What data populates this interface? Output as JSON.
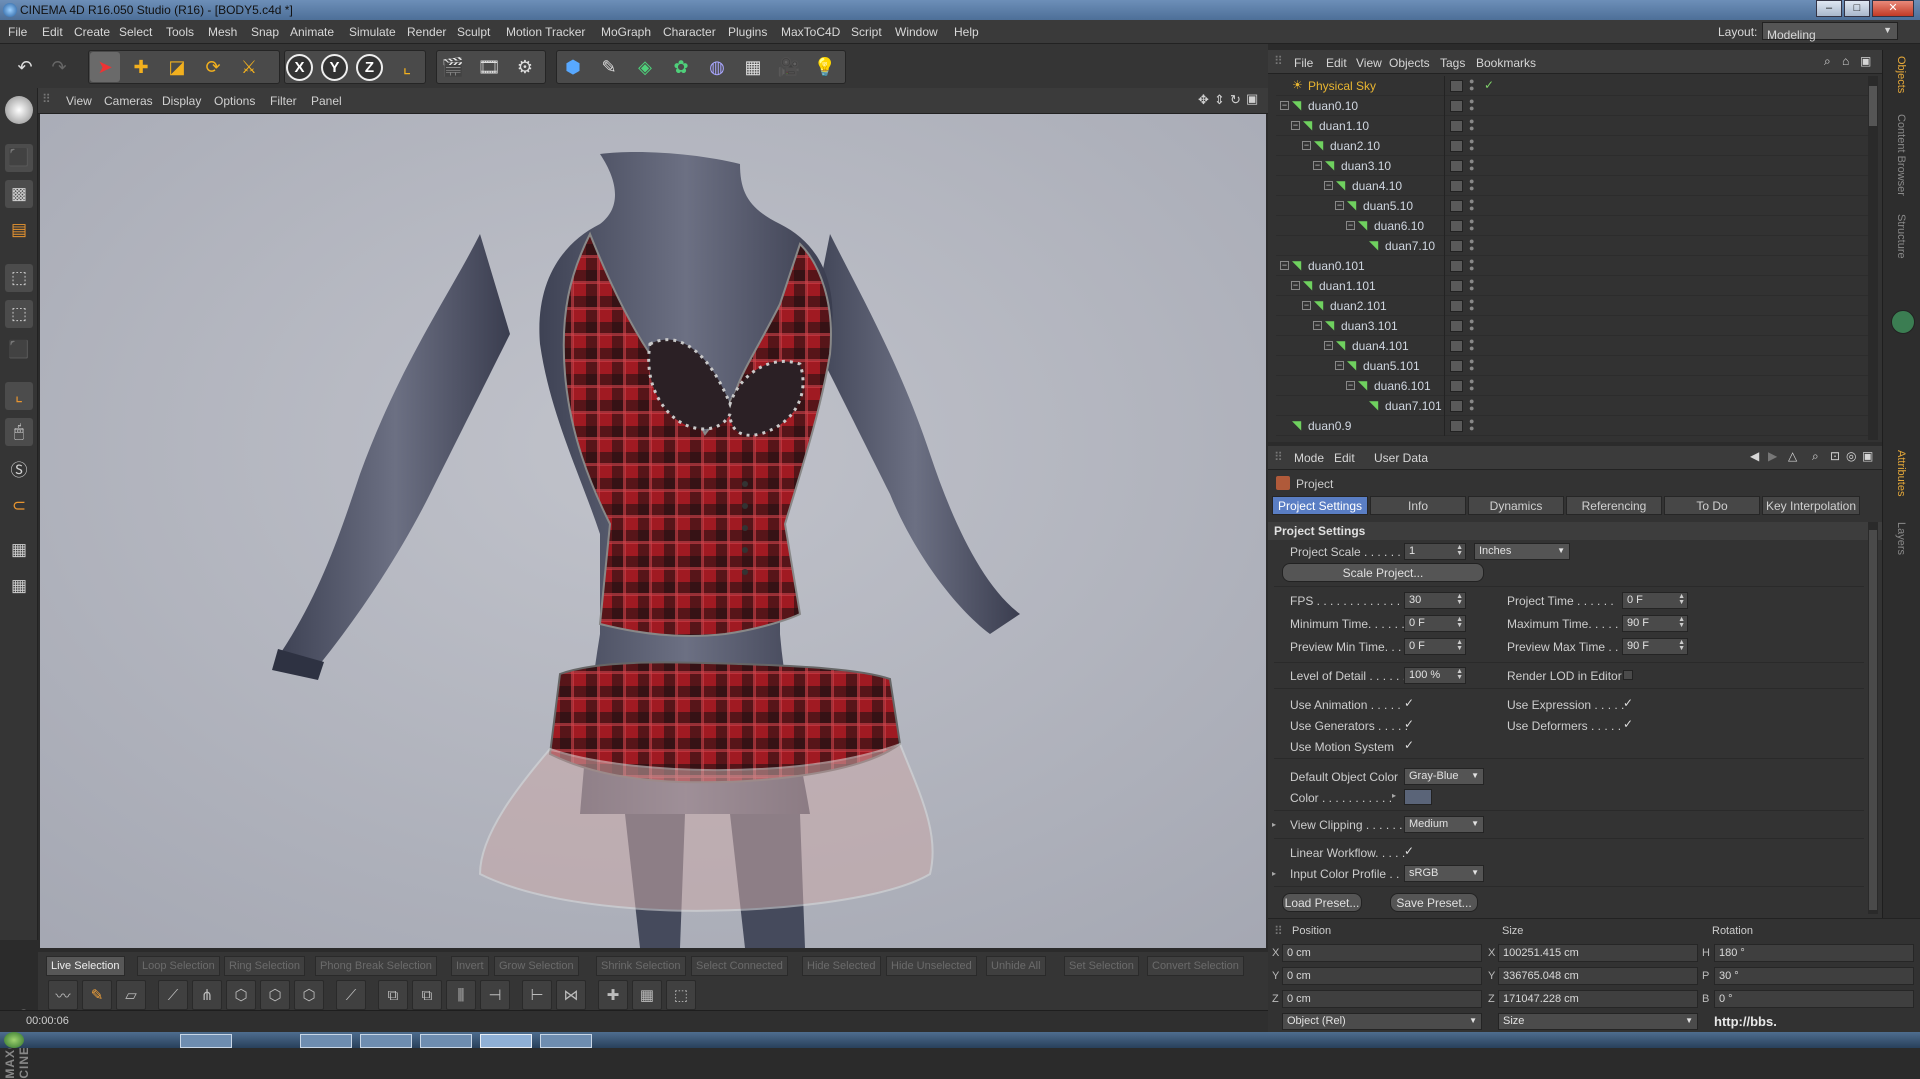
{
  "titlebar": {
    "title": "CINEMA 4D R16.050 Studio (R16) - [BODY5.c4d *]"
  },
  "menubar": {
    "items": [
      "File",
      "Edit",
      "Create",
      "Select",
      "Tools",
      "Mesh",
      "Snap",
      "Animate",
      "Simulate",
      "Render",
      "Sculpt",
      "Motion Tracker",
      "MoGraph",
      "Character",
      "Plugins",
      "MaxToC4D",
      "Script",
      "Window",
      "Help"
    ],
    "layout_label": "Layout:",
    "layout_value": "Modeling"
  },
  "toolbar": {
    "axes": [
      "X",
      "Y",
      "Z"
    ]
  },
  "viewport": {
    "menu": [
      "View",
      "Cameras",
      "Display",
      "Options",
      "Filter",
      "Panel"
    ],
    "background": "#b3b6c0"
  },
  "selection_bar": {
    "items": [
      "Live Selection",
      "Loop Selection",
      "Ring Selection",
      "Phong Break Selection",
      "Invert",
      "Grow Selection",
      "Shrink Selection",
      "Select Connected",
      "Hide Selected",
      "Hide Unselected",
      "Unhide All",
      "Set Selection",
      "Convert Selection"
    ]
  },
  "statusbar": {
    "time": "00:00:06"
  },
  "brand": "MAXON CINEMA4D",
  "object_manager": {
    "menu": [
      "File",
      "Edit",
      "View",
      "Objects",
      "Tags",
      "Bookmarks"
    ],
    "rows": [
      {
        "name": "Physical Sky",
        "depth": 0
      },
      {
        "name": "duan0.10",
        "depth": 0
      },
      {
        "name": "duan1.10",
        "depth": 1
      },
      {
        "name": "duan2.10",
        "depth": 2
      },
      {
        "name": "duan3.10",
        "depth": 3
      },
      {
        "name": "duan4.10",
        "depth": 4
      },
      {
        "name": "duan5.10",
        "depth": 5
      },
      {
        "name": "duan6.10",
        "depth": 6
      },
      {
        "name": "duan7.10",
        "depth": 7
      },
      {
        "name": "duan0.101",
        "depth": 0
      },
      {
        "name": "duan1.101",
        "depth": 1
      },
      {
        "name": "duan2.101",
        "depth": 2
      },
      {
        "name": "duan3.101",
        "depth": 3
      },
      {
        "name": "duan4.101",
        "depth": 4
      },
      {
        "name": "duan5.101",
        "depth": 5
      },
      {
        "name": "duan6.101",
        "depth": 6
      },
      {
        "name": "duan7.101",
        "depth": 7
      },
      {
        "name": "duan0.9",
        "depth": 0
      }
    ]
  },
  "side_tabs": [
    "Objects",
    "Content Browser",
    "Structure",
    "Attributes",
    "Layers"
  ],
  "attributes": {
    "menu": [
      "Mode",
      "Edit",
      "User Data"
    ],
    "object_label": "Project",
    "tabs": [
      "Project Settings",
      "Info",
      "Dynamics",
      "Referencing",
      "To Do",
      "Key Interpolation"
    ],
    "section_title": "Project Settings",
    "project_scale_label": "Project Scale . . . . . . .",
    "project_scale_value": "1",
    "project_scale_unit": "Inches",
    "scale_project_button": "Scale Project...",
    "fps_label": "FPS . . . . . . . . . . . . . . .",
    "fps_value": "30",
    "project_time_label": "Project Time . . . . . .",
    "project_time_value": "0 F",
    "min_time_label": "Minimum Time. . . . . .",
    "min_time_value": "0 F",
    "max_time_label": "Maximum Time. . . . .",
    "max_time_value": "90 F",
    "preview_min_label": "Preview Min Time. . .",
    "preview_min_value": "0 F",
    "preview_max_label": "Preview Max Time . .",
    "preview_max_value": "90 F",
    "lod_label": "Level of Detail . . . . . .",
    "lod_value": "100 %",
    "render_lod_label": "Render LOD in Editor",
    "use_animation_label": "Use Animation . . . . .",
    "use_expression_label": "Use Expression . . . . .",
    "use_generators_label": "Use Generators . . . . .",
    "use_deformers_label": "Use Deformers . . . . .",
    "use_motion_label": "Use Motion System",
    "default_color_label": "Default Object Color",
    "default_color_value": "Gray-Blue",
    "color_label": "Color . . . . . . . . . . .",
    "color_swatch": "#5a6478",
    "view_clipping_label": "View Clipping . . . . . .",
    "view_clipping_value": "Medium",
    "linear_workflow_label": "Linear Workflow. . . . .",
    "input_profile_label": "Input Color Profile . .",
    "input_profile_value": "sRGB",
    "load_preset": "Load Preset...",
    "save_preset": "Save Preset...",
    "check": "✓"
  },
  "coordinates": {
    "position_header": "Position",
    "size_header": "Size",
    "rotation_header": "Rotation",
    "pos": [
      {
        "axis": "X",
        "value": "0 cm"
      },
      {
        "axis": "Y",
        "value": "0 cm"
      },
      {
        "axis": "Z",
        "value": "0 cm"
      }
    ],
    "size": [
      {
        "axis": "X",
        "value": "100251.415 cm"
      },
      {
        "axis": "Y",
        "value": "336765.048 cm"
      },
      {
        "axis": "Z",
        "value": "171047.228 cm"
      }
    ],
    "rot": [
      {
        "axis": "H",
        "value": "180 °"
      },
      {
        "axis": "P",
        "value": "30 °"
      },
      {
        "axis": "B",
        "value": "0 °"
      }
    ],
    "mode_left": "Object (Rel)",
    "mode_right": "Size"
  },
  "watermark": "http://bbs.",
  "colors": {
    "accent": "#5a7ec4",
    "physical_sky": "#e8b531",
    "tree_icon": "#6fd15f"
  }
}
